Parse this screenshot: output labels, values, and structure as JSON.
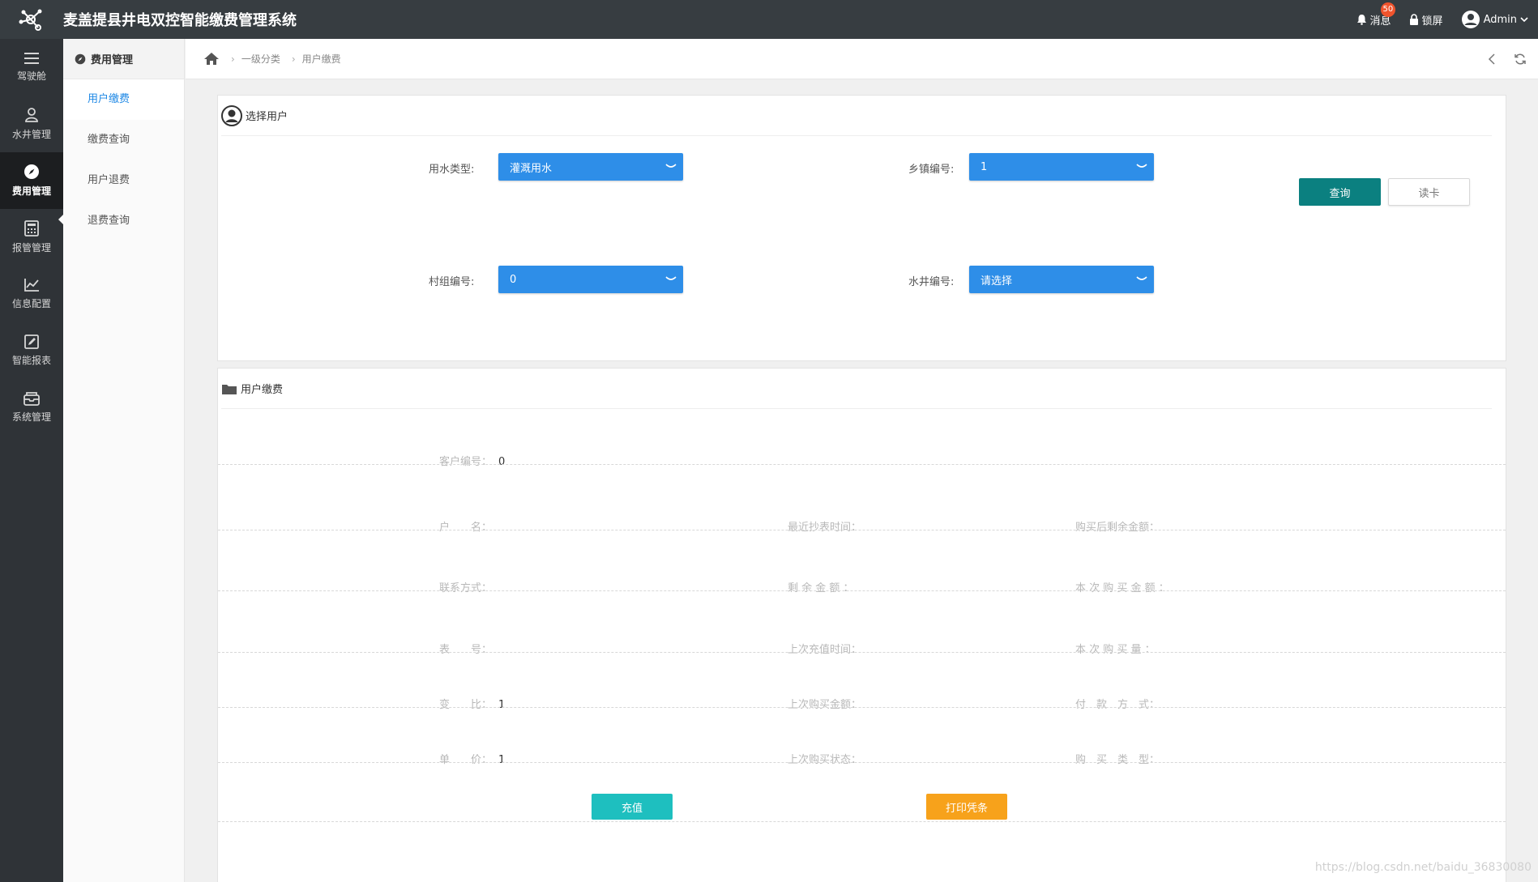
{
  "app": {
    "title": "麦盖提县井电双控智能缴费管理系统"
  },
  "topbar": {
    "messages_label": "消息",
    "messages_badge": "50",
    "lock_label": "锁屏",
    "user_label": "Admin"
  },
  "rail": [
    {
      "label": "驾驶舱",
      "icon": "menu-icon"
    },
    {
      "label": "水井管理",
      "icon": "user-group-icon"
    },
    {
      "label": "费用管理",
      "icon": "compass-icon",
      "active": true
    },
    {
      "label": "报管管理",
      "icon": "calculator-icon"
    },
    {
      "label": "信息配置",
      "icon": "chart-icon"
    },
    {
      "label": "智能报表",
      "icon": "edit-icon"
    },
    {
      "label": "系统管理",
      "icon": "inbox-icon"
    }
  ],
  "submenu": {
    "title": "费用管理",
    "items": [
      "用户缴费",
      "缴费查询",
      "用户退费",
      "退费查询"
    ]
  },
  "breadcrumb": {
    "level1": "一级分类",
    "level2": "用户缴费"
  },
  "select_panel": {
    "title": "选择用户",
    "water_type_label": "用水类型:",
    "water_type_value": "灌溉用水",
    "town_label": "乡镇编号:",
    "town_value": "1",
    "village_label": "村组编号:",
    "village_value": "0",
    "well_label": "水井编号:",
    "well_value": "请选择",
    "query_button": "查询",
    "read_card_button": "读卡"
  },
  "pay_panel": {
    "title": "用户缴费",
    "customer_no_label": "客户编号：",
    "customer_no_value": "0",
    "name_label": "户　　名：",
    "last_read_label": "最近抄表时间：",
    "balance_after_label": "购买后剩余金额：",
    "contact_label": "联系方式：",
    "remaining_label": "剩 余 金 额 ：",
    "this_amount_label": "本 次 购 买 金 额 ：",
    "meter_label": "表　　号：",
    "last_recharge_label": "上次充值时间：",
    "this_qty_label": "本 次 购 买 量 ：",
    "ratio_label": "变　　比：",
    "ratio_value": "1",
    "last_amount_label": "上次购买金额：",
    "pay_method_label": "付　款　方　式：",
    "price_label": "单　　价：",
    "price_value": "1",
    "last_status_label": "上次购买状态：",
    "buy_type_label": "购　买　类　型：",
    "recharge_button": "充值",
    "print_button": "打印凭条"
  },
  "watermark": "https://blog.csdn.net/baidu_36830080"
}
